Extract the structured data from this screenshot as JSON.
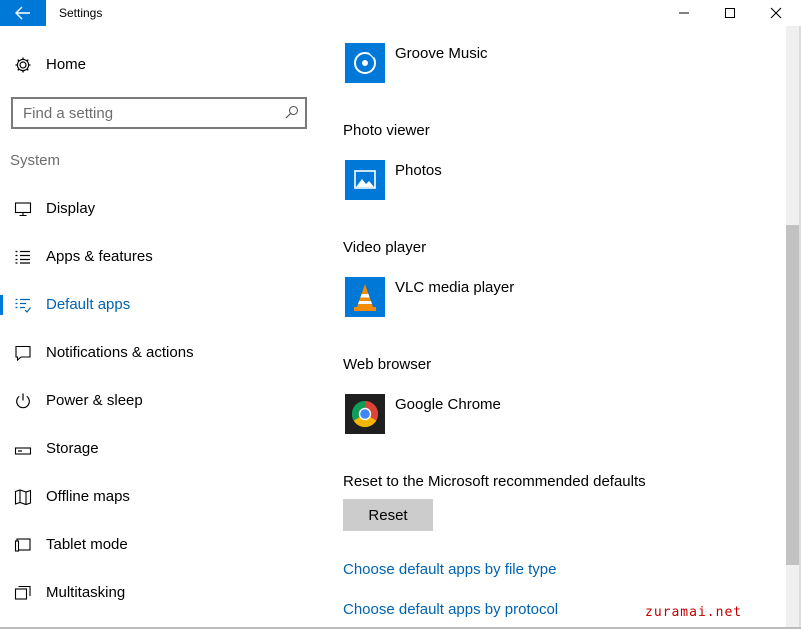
{
  "window": {
    "title": "Settings"
  },
  "nav": {
    "home_label": "Home",
    "search_placeholder": "Find a setting",
    "section_heading": "System",
    "items": [
      {
        "label": "Display",
        "icon": "monitor-icon"
      },
      {
        "label": "Apps & features",
        "icon": "list-icon"
      },
      {
        "label": "Default apps",
        "icon": "default-apps-icon",
        "active": true
      },
      {
        "label": "Notifications & actions",
        "icon": "notification-icon"
      },
      {
        "label": "Power & sleep",
        "icon": "power-icon"
      },
      {
        "label": "Storage",
        "icon": "storage-icon"
      },
      {
        "label": "Offline maps",
        "icon": "map-icon"
      },
      {
        "label": "Tablet mode",
        "icon": "tablet-icon"
      },
      {
        "label": "Multitasking",
        "icon": "multitasking-icon"
      }
    ]
  },
  "content": {
    "groups": [
      {
        "heading": "",
        "app": "Groove Music",
        "icon": "groove-music-icon"
      },
      {
        "heading": "Photo viewer",
        "app": "Photos",
        "icon": "photos-icon"
      },
      {
        "heading": "Video player",
        "app": "VLC media player",
        "icon": "vlc-icon"
      },
      {
        "heading": "Web browser",
        "app": "Google Chrome",
        "icon": "chrome-icon"
      }
    ],
    "reset_text": "Reset to the Microsoft recommended defaults",
    "reset_button": "Reset",
    "links": [
      "Choose default apps by file type",
      "Choose default apps by protocol"
    ]
  },
  "watermark": "zuramai.net",
  "colors": {
    "accent": "#0078d7",
    "link": "#0063b1",
    "watermark": "#c00000"
  }
}
